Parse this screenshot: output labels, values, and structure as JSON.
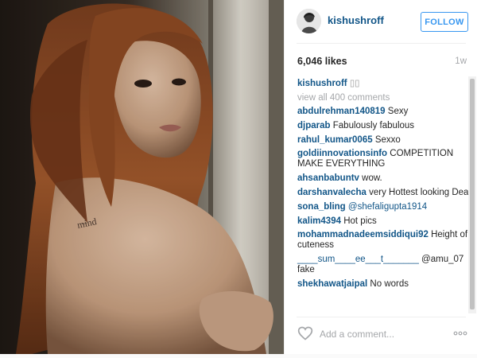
{
  "post": {
    "image_alt": "photo"
  },
  "header": {
    "username": "kishushroff",
    "follow_label": "FOLLOW"
  },
  "stats": {
    "likes": "6,046 likes",
    "time_ago": "1w"
  },
  "caption": {
    "author": "kishushroff",
    "text": "▯▯"
  },
  "view_all": "view all 400 comments",
  "comments": [
    {
      "author": "abdulrehman140819",
      "text": "Sexy"
    },
    {
      "author": "djparab",
      "text": "Fabulously fabulous"
    },
    {
      "author": "rahul_kumar0065",
      "text": "Sexxo"
    },
    {
      "author": "goldiinnovationsinfo",
      "text": "COMPETITION MAKE EVERYTHING"
    },
    {
      "author": "ahsanbabuntv",
      "text": "wow."
    },
    {
      "author": "darshanvalecha",
      "text": "very Hottest looking Dear"
    },
    {
      "author": "sona_bling",
      "text": "@shefaligupta1914"
    },
    {
      "author": "kalim4394",
      "text": "Hot pics"
    },
    {
      "author": "mohammadnadeemsiddiqui92",
      "text": "Height of cuteness"
    },
    {
      "author": "____sum____ee___t_______",
      "text": "@amu_07 fake"
    },
    {
      "author": "shekhawatjaipal",
      "text": "No words"
    }
  ],
  "footer": {
    "add_comment_placeholder": "Add a comment..."
  },
  "icons": {
    "like": "heart-icon",
    "options": "more-icon"
  },
  "colors": {
    "link": "#125688",
    "follow": "#3897f0",
    "muted": "#a5a7aa"
  }
}
